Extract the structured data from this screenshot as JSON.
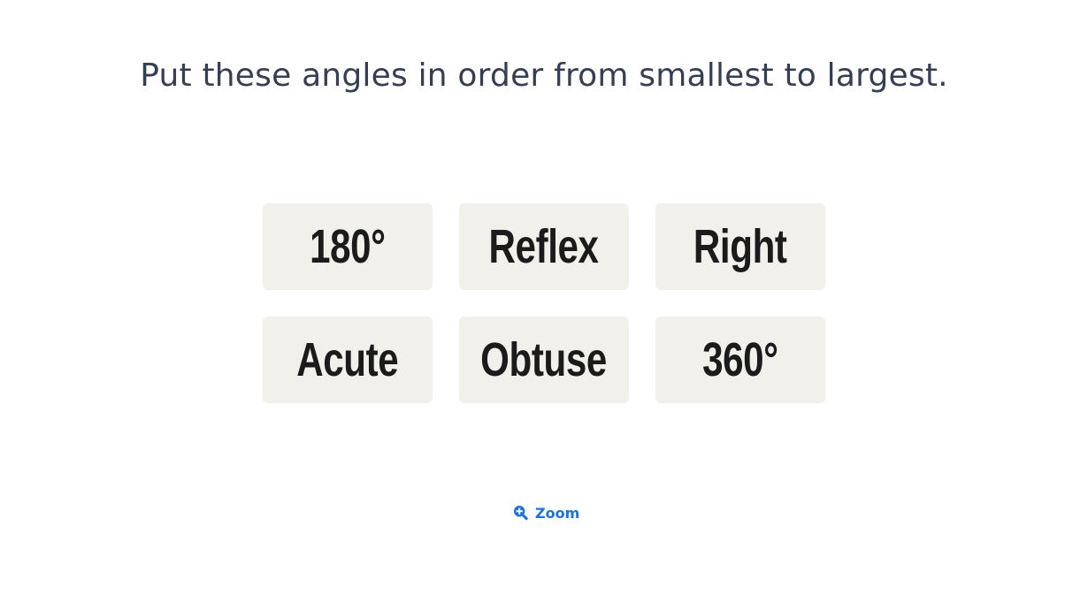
{
  "question": {
    "text": "Put these angles in order from smallest to largest."
  },
  "cards": [
    {
      "label": "180°"
    },
    {
      "label": "Reflex"
    },
    {
      "label": "Right"
    },
    {
      "label": "Acute"
    },
    {
      "label": "Obtuse"
    },
    {
      "label": "360°"
    }
  ],
  "zoom": {
    "label": "Zoom",
    "icon": "zoom-in-icon"
  },
  "colors": {
    "question_text": "#353e52",
    "card_background": "#f2f0ea",
    "card_text": "#1b1b1b",
    "accent": "#1f73d8"
  }
}
